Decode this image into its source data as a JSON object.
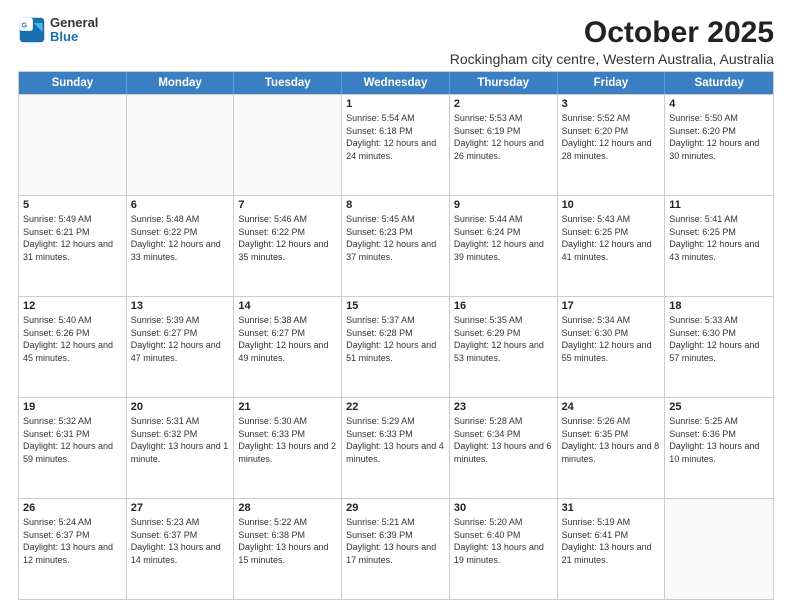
{
  "logo": {
    "general": "General",
    "blue": "Blue"
  },
  "title": "October 2025",
  "subtitle": "Rockingham city centre, Western Australia, Australia",
  "days": [
    "Sunday",
    "Monday",
    "Tuesday",
    "Wednesday",
    "Thursday",
    "Friday",
    "Saturday"
  ],
  "weeks": [
    [
      {
        "day": "",
        "info": ""
      },
      {
        "day": "",
        "info": ""
      },
      {
        "day": "",
        "info": ""
      },
      {
        "day": "1",
        "info": "Sunrise: 5:54 AM\nSunset: 6:18 PM\nDaylight: 12 hours and 24 minutes."
      },
      {
        "day": "2",
        "info": "Sunrise: 5:53 AM\nSunset: 6:19 PM\nDaylight: 12 hours and 26 minutes."
      },
      {
        "day": "3",
        "info": "Sunrise: 5:52 AM\nSunset: 6:20 PM\nDaylight: 12 hours and 28 minutes."
      },
      {
        "day": "4",
        "info": "Sunrise: 5:50 AM\nSunset: 6:20 PM\nDaylight: 12 hours and 30 minutes."
      }
    ],
    [
      {
        "day": "5",
        "info": "Sunrise: 5:49 AM\nSunset: 6:21 PM\nDaylight: 12 hours and 31 minutes."
      },
      {
        "day": "6",
        "info": "Sunrise: 5:48 AM\nSunset: 6:22 PM\nDaylight: 12 hours and 33 minutes."
      },
      {
        "day": "7",
        "info": "Sunrise: 5:46 AM\nSunset: 6:22 PM\nDaylight: 12 hours and 35 minutes."
      },
      {
        "day": "8",
        "info": "Sunrise: 5:45 AM\nSunset: 6:23 PM\nDaylight: 12 hours and 37 minutes."
      },
      {
        "day": "9",
        "info": "Sunrise: 5:44 AM\nSunset: 6:24 PM\nDaylight: 12 hours and 39 minutes."
      },
      {
        "day": "10",
        "info": "Sunrise: 5:43 AM\nSunset: 6:25 PM\nDaylight: 12 hours and 41 minutes."
      },
      {
        "day": "11",
        "info": "Sunrise: 5:41 AM\nSunset: 6:25 PM\nDaylight: 12 hours and 43 minutes."
      }
    ],
    [
      {
        "day": "12",
        "info": "Sunrise: 5:40 AM\nSunset: 6:26 PM\nDaylight: 12 hours and 45 minutes."
      },
      {
        "day": "13",
        "info": "Sunrise: 5:39 AM\nSunset: 6:27 PM\nDaylight: 12 hours and 47 minutes."
      },
      {
        "day": "14",
        "info": "Sunrise: 5:38 AM\nSunset: 6:27 PM\nDaylight: 12 hours and 49 minutes."
      },
      {
        "day": "15",
        "info": "Sunrise: 5:37 AM\nSunset: 6:28 PM\nDaylight: 12 hours and 51 minutes."
      },
      {
        "day": "16",
        "info": "Sunrise: 5:35 AM\nSunset: 6:29 PM\nDaylight: 12 hours and 53 minutes."
      },
      {
        "day": "17",
        "info": "Sunrise: 5:34 AM\nSunset: 6:30 PM\nDaylight: 12 hours and 55 minutes."
      },
      {
        "day": "18",
        "info": "Sunrise: 5:33 AM\nSunset: 6:30 PM\nDaylight: 12 hours and 57 minutes."
      }
    ],
    [
      {
        "day": "19",
        "info": "Sunrise: 5:32 AM\nSunset: 6:31 PM\nDaylight: 12 hours and 59 minutes."
      },
      {
        "day": "20",
        "info": "Sunrise: 5:31 AM\nSunset: 6:32 PM\nDaylight: 13 hours and 1 minute."
      },
      {
        "day": "21",
        "info": "Sunrise: 5:30 AM\nSunset: 6:33 PM\nDaylight: 13 hours and 2 minutes."
      },
      {
        "day": "22",
        "info": "Sunrise: 5:29 AM\nSunset: 6:33 PM\nDaylight: 13 hours and 4 minutes."
      },
      {
        "day": "23",
        "info": "Sunrise: 5:28 AM\nSunset: 6:34 PM\nDaylight: 13 hours and 6 minutes."
      },
      {
        "day": "24",
        "info": "Sunrise: 5:26 AM\nSunset: 6:35 PM\nDaylight: 13 hours and 8 minutes."
      },
      {
        "day": "25",
        "info": "Sunrise: 5:25 AM\nSunset: 6:36 PM\nDaylight: 13 hours and 10 minutes."
      }
    ],
    [
      {
        "day": "26",
        "info": "Sunrise: 5:24 AM\nSunset: 6:37 PM\nDaylight: 13 hours and 12 minutes."
      },
      {
        "day": "27",
        "info": "Sunrise: 5:23 AM\nSunset: 6:37 PM\nDaylight: 13 hours and 14 minutes."
      },
      {
        "day": "28",
        "info": "Sunrise: 5:22 AM\nSunset: 6:38 PM\nDaylight: 13 hours and 15 minutes."
      },
      {
        "day": "29",
        "info": "Sunrise: 5:21 AM\nSunset: 6:39 PM\nDaylight: 13 hours and 17 minutes."
      },
      {
        "day": "30",
        "info": "Sunrise: 5:20 AM\nSunset: 6:40 PM\nDaylight: 13 hours and 19 minutes."
      },
      {
        "day": "31",
        "info": "Sunrise: 5:19 AM\nSunset: 6:41 PM\nDaylight: 13 hours and 21 minutes."
      },
      {
        "day": "",
        "info": ""
      }
    ]
  ]
}
